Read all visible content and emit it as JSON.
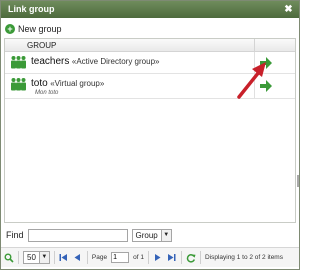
{
  "window": {
    "title": "Link group",
    "close_icon": "close-icon"
  },
  "toolbar": {
    "new_group_label": "New group"
  },
  "grid": {
    "column_header": "GROUP",
    "rows": [
      {
        "name": "teachers",
        "type": "«Active Directory group»",
        "description": ""
      },
      {
        "name": "toto",
        "type": "«Virtual group»",
        "description": "Mon toto"
      }
    ]
  },
  "find": {
    "label": "Find",
    "value": "",
    "filter_value": "Group"
  },
  "pager": {
    "per_page": "50",
    "page_label": "Page",
    "page_value": "1",
    "of_label": "of 1",
    "status": "Displaying 1 to 2 of 2 items"
  },
  "colors": {
    "titlebar": "#5c7a4a",
    "accent_green": "#3b9a38",
    "annotation_arrow": "#c8202a"
  }
}
